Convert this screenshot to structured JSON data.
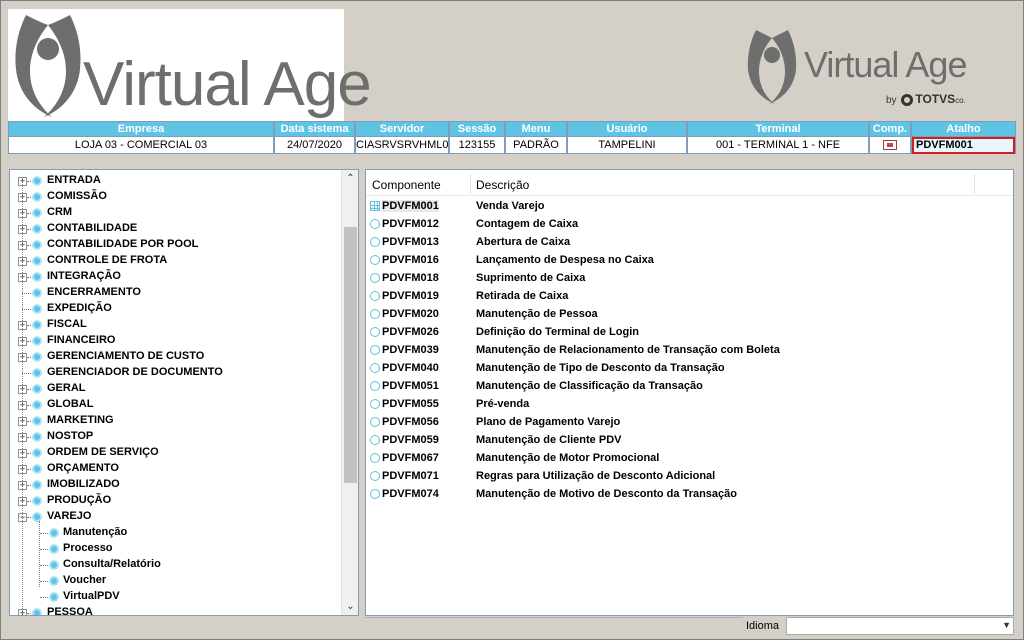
{
  "brand": {
    "logo_text": "Virtual Age",
    "by_prefix": "by",
    "totvs_text": "TOTVS",
    "totvs_suffix": "co."
  },
  "info_header": {
    "columns": [
      {
        "header": "Empresa",
        "value": "LOJA 03 - COMERCIAL 03"
      },
      {
        "header": "Data sistema",
        "value": "24/07/2020"
      },
      {
        "header": "Servidor",
        "value": "CIASRVSRVHML0"
      },
      {
        "header": "Sessão",
        "value": "123155"
      },
      {
        "header": "Menu",
        "value": "PADRÃO"
      },
      {
        "header": "Usuário",
        "value": "TAMPELINI"
      },
      {
        "header": "Terminal",
        "value": "001 - TERMINAL 1 - NFE"
      },
      {
        "header": "Comp.",
        "value": ""
      },
      {
        "header": "Atalho",
        "value": "PDVFM001"
      }
    ]
  },
  "tree": {
    "items": [
      {
        "label": "ENTRADA",
        "expandable": true
      },
      {
        "label": "COMISSÃO",
        "expandable": true
      },
      {
        "label": "CRM",
        "expandable": true
      },
      {
        "label": "CONTABILIDADE",
        "expandable": true
      },
      {
        "label": "CONTABILIDADE POR POOL",
        "expandable": true
      },
      {
        "label": "CONTROLE DE FROTA",
        "expandable": true
      },
      {
        "label": "INTEGRAÇÃO",
        "expandable": true
      },
      {
        "label": "ENCERRAMENTO",
        "expandable": false
      },
      {
        "label": "EXPEDIÇÃO",
        "expandable": false
      },
      {
        "label": "FISCAL",
        "expandable": true
      },
      {
        "label": "FINANCEIRO",
        "expandable": true
      },
      {
        "label": "GERENCIAMENTO DE CUSTO",
        "expandable": true
      },
      {
        "label": "GERENCIADOR DE DOCUMENTO",
        "expandable": false
      },
      {
        "label": "GERAL",
        "expandable": true
      },
      {
        "label": "GLOBAL",
        "expandable": true
      },
      {
        "label": "MARKETING",
        "expandable": true
      },
      {
        "label": "NOSTOP",
        "expandable": true
      },
      {
        "label": "ORDEM DE SERVIÇO",
        "expandable": true
      },
      {
        "label": "ORÇAMENTO",
        "expandable": true
      },
      {
        "label": "IMOBILIZADO",
        "expandable": true
      },
      {
        "label": "PRODUÇÃO",
        "expandable": true
      },
      {
        "label": "VAREJO",
        "expandable": true,
        "expanded": true
      },
      {
        "label": "Manutenção",
        "child": true
      },
      {
        "label": "Processo",
        "child": true
      },
      {
        "label": "Consulta/Relatório",
        "child": true
      },
      {
        "label": "Voucher",
        "child": true
      },
      {
        "label": "VirtualPDV",
        "child": true
      },
      {
        "label": "PESSOA",
        "expandable": true
      }
    ]
  },
  "list": {
    "col_component": "Componente",
    "col_description": "Descrição",
    "rows": [
      {
        "code": "PDVFM001",
        "desc": "Venda Varejo"
      },
      {
        "code": "PDVFM012",
        "desc": "Contagem de Caixa"
      },
      {
        "code": "PDVFM013",
        "desc": "Abertura de Caixa"
      },
      {
        "code": "PDVFM016",
        "desc": "Lançamento de Despesa no Caixa"
      },
      {
        "code": "PDVFM018",
        "desc": "Suprimento de Caixa"
      },
      {
        "code": "PDVFM019",
        "desc": "Retirada de Caixa"
      },
      {
        "code": "PDVFM020",
        "desc": "Manutenção de Pessoa"
      },
      {
        "code": "PDVFM026",
        "desc": "Definição do Terminal de Login"
      },
      {
        "code": "PDVFM039",
        "desc": "Manutenção de Relacionamento de Transação com Boleta"
      },
      {
        "code": "PDVFM040",
        "desc": "Manutenção de Tipo de Desconto da Transação"
      },
      {
        "code": "PDVFM051",
        "desc": "Manutenção de Classificação da Transação"
      },
      {
        "code": "PDVFM055",
        "desc": "Pré-venda"
      },
      {
        "code": "PDVFM056",
        "desc": "Plano de Pagamento Varejo"
      },
      {
        "code": "PDVFM059",
        "desc": "Manutenção de Cliente PDV"
      },
      {
        "code": "PDVFM067",
        "desc": "Manutenção de Motor Promocional"
      },
      {
        "code": "PDVFM071",
        "desc": "Regras para Utilização de Desconto Adicional"
      },
      {
        "code": "PDVFM074",
        "desc": "Manutenção de Motivo de Desconto da Transação"
      }
    ]
  },
  "footer": {
    "idioma_label": "Idioma",
    "idioma_value": ""
  },
  "colors": {
    "accent": "#5fc3e4",
    "shortcut_border": "#d21e1e",
    "logo_gray": "#6e6e6e"
  }
}
